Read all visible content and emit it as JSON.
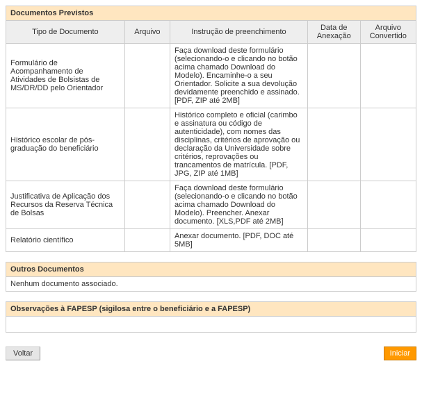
{
  "documentos_previstos": {
    "title": "Documentos Previstos",
    "headers": {
      "tipo": "Tipo de Documento",
      "arquivo": "Arquivo",
      "instrucao": "Instrução de preenchimento",
      "data": "Data de Anexação",
      "convertido": "Arquivo Convertido"
    },
    "rows": [
      {
        "tipo": "Formulário de Acompanhamento de Atividades de Bolsistas de MS/DR/DD pelo Orientador",
        "arquivo": "",
        "instrucao": "Faça download deste formulário (selecionando-o e clicando no botão acima chamado Download do Modelo). Encaminhe-o a seu Orientador. Solicite a sua devolução devidamente preenchido e assinado.[PDF, ZIP até 2MB]",
        "data": "",
        "convertido": ""
      },
      {
        "tipo": "Histórico escolar de pós-graduação do beneficiário",
        "arquivo": "",
        "instrucao": "Histórico completo e oficial (carimbo e assinatura ou código de autenticidade), com nomes das disciplinas, critérios de aprovação ou declaração da Universidade sobre critérios, reprovações ou trancamentos de matrícula. [PDF, JPG, ZIP até 1MB]",
        "data": "",
        "convertido": ""
      },
      {
        "tipo": "Justificativa de Aplicação dos Recursos da Reserva Técnica de Bolsas",
        "arquivo": "",
        "instrucao": "Faça download deste formulário (selecionando-o e clicando no botão acima chamado Download do Modelo). Preencher. Anexar documento. [XLS,PDF até 2MB]",
        "data": "",
        "convertido": ""
      },
      {
        "tipo": "Relatório científico",
        "arquivo": "",
        "instrucao": "Anexar documento. [PDF, DOC até 5MB]",
        "data": "",
        "convertido": ""
      }
    ]
  },
  "outros_documentos": {
    "title": "Outros Documentos",
    "message": "Nenhum documento associado."
  },
  "observacoes": {
    "title": "Observações à FAPESP (sigilosa entre o beneficiário e a FAPESP)"
  },
  "buttons": {
    "voltar": "Voltar",
    "iniciar": "Iniciar"
  }
}
